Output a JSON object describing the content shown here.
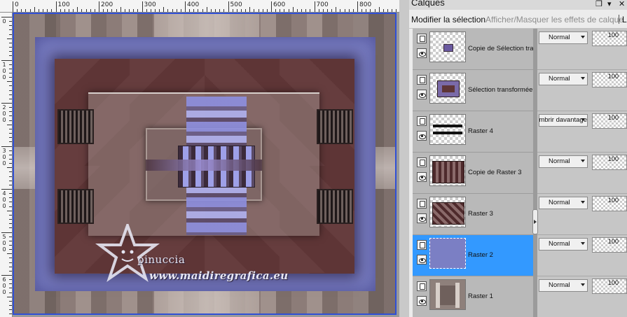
{
  "rulers": {
    "horizontal": [
      "0",
      "100",
      "200",
      "300",
      "400",
      "500",
      "600",
      "700",
      "800"
    ],
    "vertical": [
      "0",
      "1",
      "2",
      "3",
      "4",
      "5",
      "6"
    ]
  },
  "watermark": {
    "name": "pinuccia",
    "url": "www.maidiregrafica.eu"
  },
  "panel": {
    "title": "Calques",
    "title_buttons": [
      "❒",
      "▾",
      "✕"
    ],
    "toolbar": {
      "modify_selection": "Modifier la sélection",
      "toggle_effects": "Afficher/Masquer les effets de calque",
      "extra": "L"
    }
  },
  "layers": [
    {
      "name": "Copie de Sélection transformée",
      "blend": "Normal",
      "opacity": "100",
      "selected": false
    },
    {
      "name": "Sélection transformée",
      "blend": "Normal",
      "opacity": "100",
      "selected": false
    },
    {
      "name": "Raster 4",
      "blend": "Assombrir davantage",
      "opacity": "100",
      "selected": false
    },
    {
      "name": "Copie de Raster 3",
      "blend": "Normal",
      "opacity": "100",
      "selected": false
    },
    {
      "name": "Raster 3",
      "blend": "Normal",
      "opacity": "100",
      "selected": false
    },
    {
      "name": "Raster 2",
      "blend": "Normal",
      "opacity": "100",
      "selected": true
    },
    {
      "name": "Raster 1",
      "blend": "Normal",
      "opacity": "100",
      "selected": false
    }
  ],
  "colors": {
    "selection_highlight": "#3399ff",
    "image_border": "#2f4fd6",
    "periwinkle_frame": "#7b7fc4",
    "brown_fill": "#5e3536"
  }
}
